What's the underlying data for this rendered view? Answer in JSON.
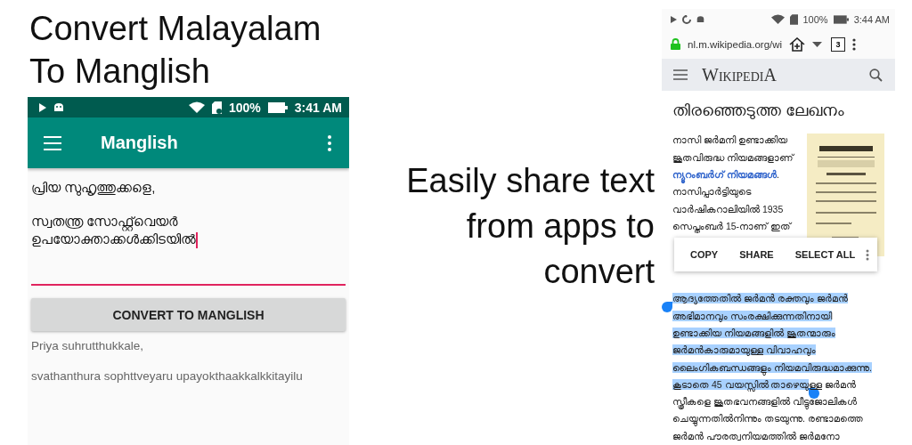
{
  "headline": [
    "Convert Malayalam",
    "To Manglish"
  ],
  "tagline": [
    "Easily share text",
    "from apps to",
    "convert"
  ],
  "left_phone": {
    "status_bar": {
      "battery": "100%",
      "time": "3:41 AM"
    },
    "app_bar": {
      "title": "Manglish"
    },
    "input": {
      "focused": true,
      "paragraphs": [
        [
          "പ്രിയ സുഹൃത്തുക്കളെ,"
        ],
        [
          "സ്വതന്ത്ര സോഫ്റ്റ്‌വെയർ",
          "ഉപയോക്താക്കൾക്കിടയിൽ"
        ]
      ]
    },
    "button": "CONVERT TO MANGLISH",
    "output": [
      "Priya suhrutthukkale,",
      "svathanthura sophttveyaru upayokthaakkalkkitayilu"
    ]
  },
  "right_phone": {
    "status_bar": {
      "battery": "100%",
      "time": "3:44 AM"
    },
    "browser": {
      "url": "nl.m.wikipedia.org/wi",
      "tab_count": "3"
    },
    "wiki_header": {
      "logo": "WikipediA"
    },
    "article": {
      "title": "തിരഞ്ഞെടുത്ത ലേഖനം",
      "image": {
        "kind": "picture"
      },
      "lines_beside_image": [
        [
          {
            "kind": "text",
            "selected": false,
            "text": "നാസി ജർമനി ഉണ്ടാക്കിയ"
          }
        ],
        [
          {
            "kind": "text",
            "selected": false,
            "text": "ജൂതവിരുദ്ധ നിയമങ്ങളാണ്"
          }
        ],
        [
          {
            "kind": "link",
            "selected": false,
            "text": "ന്യൂറംബർഗ് നിയമങ്ങൾ"
          },
          {
            "kind": "text",
            "selected": false,
            "text": "."
          }
        ],
        [
          {
            "kind": "text",
            "selected": false,
            "text": "നാസിപ്പാർട്ടിയുടെ"
          }
        ],
        [
          {
            "kind": "text",
            "selected": false,
            "text": "വാർഷികറാലിയിൽ 1935"
          }
        ],
        [
          {
            "kind": "text",
            "selected": false,
            "text": "സെപ്തംബർ 15-നാണ് ഇത്"
          }
        ]
      ],
      "lines_below": [
        [
          {
            "kind": "text",
            "selected": true,
            "text": "ആദ്യത്തേതിൽ ജർമൻ രക്തവും ജർമൻ"
          }
        ],
        [
          {
            "kind": "text",
            "selected": true,
            "text": "അഭിമാനവും സംരക്ഷിക്കുന്നതിനായി"
          }
        ],
        [
          {
            "kind": "text",
            "selected": true,
            "text": "ഉണ്ടാക്കിയ നിയമങ്ങളിൽ ജൂതന്മാരും"
          }
        ],
        [
          {
            "kind": "text",
            "selected": true,
            "text": "ജർമൻകാരുമായുള്ള വിവാഹവും"
          }
        ],
        [
          {
            "kind": "text",
            "selected": true,
            "text": "ലൈംഗികബന്ധങ്ങളും നിയമവിരുദ്ധമാക്കുന്നു."
          }
        ],
        [
          {
            "kind": "text",
            "selected": true,
            "text": "കൂടാതെ 45 വയസ്സിൽ താഴെയു"
          },
          {
            "kind": "text",
            "selected": false,
            "text": "ള്ള ജർമൻ"
          }
        ],
        [
          {
            "kind": "text",
            "selected": false,
            "text": "സ്ത്രീകളെ ജൂതഭവനങ്ങളിൽ വീട്ടുജോലികൾ"
          }
        ],
        [
          {
            "kind": "text",
            "selected": false,
            "text": "ചെയ്യുന്നതിൽനിന്നും തടയുന്നു. രണ്ടാമത്തെ"
          }
        ],
        [
          {
            "kind": "text",
            "selected": false,
            "text": "ജർമൻ പൗരത്വനിയമത്തിൽ ജർമനോ"
          }
        ]
      ]
    },
    "selection_menu": [
      "COPY",
      "SHARE",
      "SELECT ALL"
    ]
  }
}
